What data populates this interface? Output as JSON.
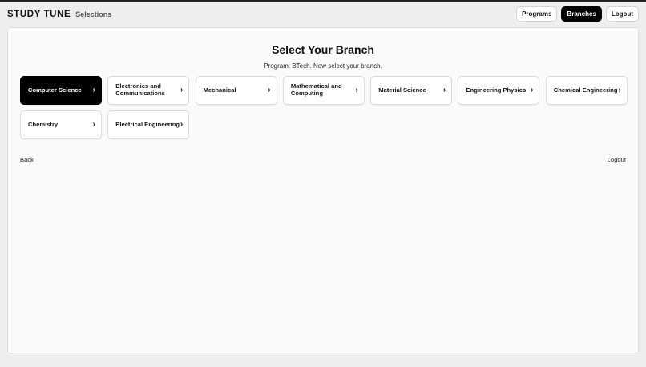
{
  "header": {
    "brand": "STUDY TUNE",
    "section": "Selections",
    "nav": [
      {
        "label": "Programs",
        "active": false
      },
      {
        "label": "Branches",
        "active": true
      },
      {
        "label": "Logout",
        "active": false
      }
    ]
  },
  "main": {
    "title": "Select Your Branch",
    "subtitle": "Program: BTech. Now select your branch.",
    "chevron": "›",
    "branches": [
      {
        "label": "Computer Science",
        "selected": true
      },
      {
        "label": "Electronics and Communications",
        "selected": false
      },
      {
        "label": "Mechanical",
        "selected": false
      },
      {
        "label": "Mathematical and Computing",
        "selected": false
      },
      {
        "label": "Material Science",
        "selected": false
      },
      {
        "label": "Engineering Physics",
        "selected": false
      },
      {
        "label": "Chemical Engineering",
        "selected": false
      },
      {
        "label": "Chemistry",
        "selected": false
      },
      {
        "label": "Electrical Engineering",
        "selected": false
      }
    ],
    "back_label": "Back",
    "logout_label": "Logout"
  },
  "colors": {
    "accent": "#000000",
    "background": "#eeeeee",
    "panel": "#fafafa"
  }
}
